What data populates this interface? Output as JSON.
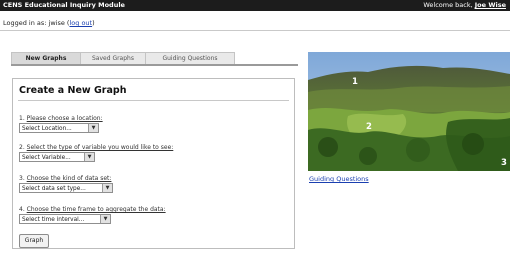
{
  "header": {
    "title": "CENS Educational Inquiry Module",
    "welcome_prefix": "Welcome back,",
    "user_name": "Joe Wise"
  },
  "login": {
    "prefix": "Logged in as: jwise (",
    "logout": "log out",
    "suffix": ")"
  },
  "tabs": [
    {
      "label": "New Graphs",
      "active": true
    },
    {
      "label": "Saved Graphs",
      "active": false
    },
    {
      "label": "Guiding Questions",
      "active": false
    }
  ],
  "form": {
    "title": "Create a New Graph",
    "questions": [
      {
        "number": "1.",
        "text": "Please choose a location:",
        "select": "Select Location..."
      },
      {
        "number": "2.",
        "text": "Select the type of variable you would like to see:",
        "select": "Select Variable..."
      },
      {
        "number": "3.",
        "text": "Choose the kind of data set:",
        "select": "Select data set type..."
      },
      {
        "number": "4.",
        "text": "Choose the time frame to aggregate the data:",
        "select": "Select time interval..."
      }
    ],
    "submit_label": "Graph"
  },
  "photo": {
    "markers": [
      "1",
      "2",
      "3"
    ],
    "link": "Guiding Questions"
  }
}
